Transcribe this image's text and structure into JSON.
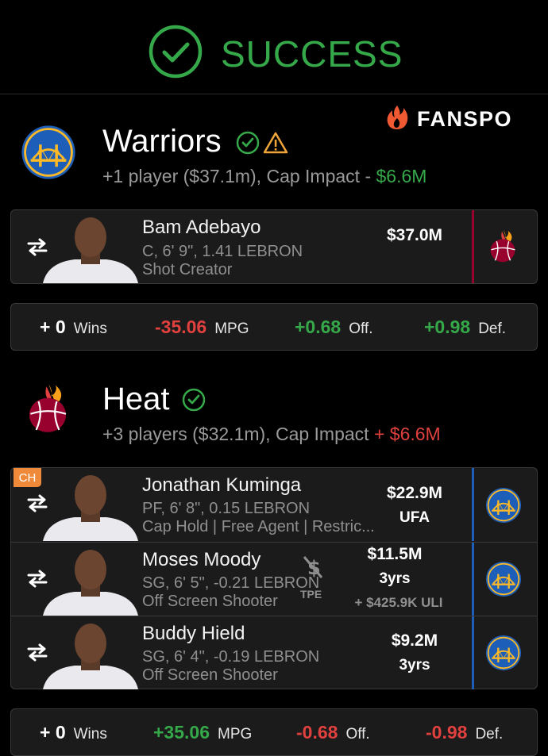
{
  "header": {
    "status": "SUCCESS"
  },
  "brand": {
    "name": "FANSPO"
  },
  "teams": [
    {
      "name": "Warriors",
      "summary_prefix": "+1 player ($37.1m), Cap Impact - ",
      "cap_impact": "$6.6M",
      "receives": [
        {
          "name": "Bam Adebayo",
          "line1": "C, 6' 9\", 1.41 LEBRON",
          "line2": "Shot Creator",
          "salary": "$37.0M",
          "contract": "",
          "from_team_logo": "heat-logo"
        }
      ],
      "stats": {
        "wins_value": "+ 0",
        "wins_label": "Wins",
        "mpg_value": "-35.06",
        "mpg_label": "MPG",
        "off_value": "+0.68",
        "off_label": "Off.",
        "def_value": "+0.98",
        "def_label": "Def."
      }
    },
    {
      "name": "Heat",
      "summary_prefix": "+3 players ($32.1m), Cap Impact ",
      "cap_impact": "+ $6.6M",
      "receives": [
        {
          "badge": "CH",
          "name": "Jonathan Kuminga",
          "line1": "PF, 6' 8\", 0.15 LEBRON",
          "line2": "Cap Hold | Free Agent | Restric...",
          "salary": "$22.9M",
          "contract": "UFA",
          "from_team_logo": "warriors-logo"
        },
        {
          "name": "Moses Moody",
          "line1": "SG, 6' 5\", -0.21 LEBRON",
          "line2": "Off Screen Shooter",
          "tpe_label": "TPE",
          "salary": "$11.5M",
          "contract": "3yrs",
          "extra": "+ $425.9K ULI",
          "from_team_logo": "warriors-logo"
        },
        {
          "name": "Buddy Hield",
          "line1": "SG, 6' 4\", -0.19 LEBRON",
          "line2": "Off Screen Shooter",
          "salary": "$9.2M",
          "contract": "3yrs",
          "from_team_logo": "warriors-logo"
        }
      ],
      "stats": {
        "wins_value": "+ 0",
        "wins_label": "Wins",
        "mpg_value": "+35.06",
        "mpg_label": "MPG",
        "off_value": "-0.68",
        "off_label": "Off.",
        "def_value": "-0.98",
        "def_label": "Def."
      }
    }
  ],
  "colors": {
    "green": "#35a84a",
    "red": "#e0413f",
    "brand_orange": "#ef5a32",
    "heat_bar": "#98002e",
    "warriors_bar": "#1d5fb8"
  }
}
